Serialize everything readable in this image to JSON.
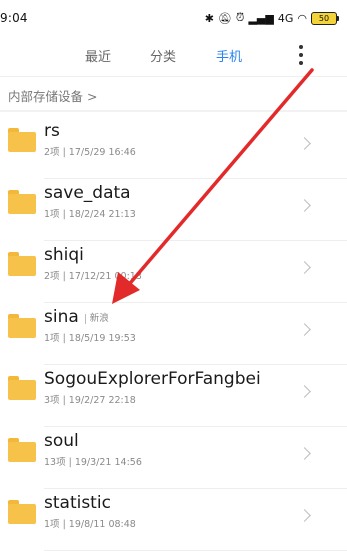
{
  "status_bar": {
    "time": "9:04",
    "network": "4G",
    "battery": "50"
  },
  "tabs": [
    {
      "label": "最近",
      "active": false
    },
    {
      "label": "分类",
      "active": false
    },
    {
      "label": "手机",
      "active": true
    }
  ],
  "breadcrumb": "内部存储设备 >",
  "files": [
    {
      "name": "rs",
      "count": "2项",
      "date": "17/5/29 16:46"
    },
    {
      "name": "save_data",
      "count": "1项",
      "date": "18/2/24 21:13"
    },
    {
      "name": "shiqi",
      "count": "2项",
      "date": "17/12/21 00:13"
    },
    {
      "name": "sina",
      "tag": "新浪",
      "count": "1项",
      "date": "18/5/19 19:53"
    },
    {
      "name": "SogouExplorerForFangbei",
      "count": "3项",
      "date": "19/2/27 22:18"
    },
    {
      "name": "soul",
      "count": "13项",
      "date": "19/3/21 14:56"
    },
    {
      "name": "statistic",
      "count": "1项",
      "date": "19/8/11 08:48"
    }
  ],
  "colors": {
    "accent": "#2b84f1",
    "folder": "#f7c24a",
    "annotation_arrow": "#e32a2a"
  },
  "icons": [
    "bluetooth-icon",
    "mute-icon",
    "alarm-icon",
    "signal-icon",
    "wifi-icon",
    "battery-icon",
    "more-icon",
    "chevron-right-icon",
    "folder-icon"
  ]
}
